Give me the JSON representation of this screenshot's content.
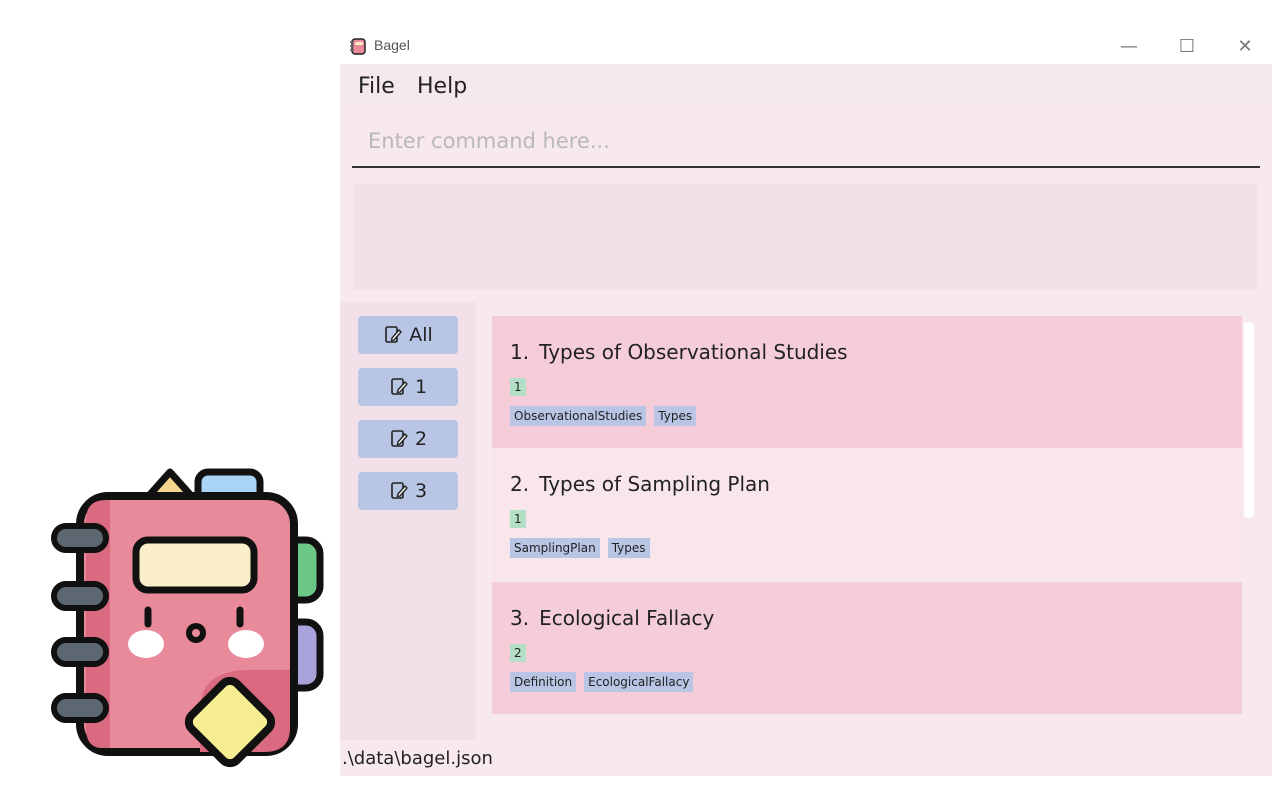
{
  "window": {
    "title": "Bagel",
    "controls": {
      "minimize": "—",
      "maximize": "☐",
      "close": "✕"
    }
  },
  "menu": {
    "items": [
      {
        "label": "File"
      },
      {
        "label": "Help"
      }
    ]
  },
  "command": {
    "placeholder": "Enter command here...",
    "value": ""
  },
  "result": {
    "text": ""
  },
  "tabs": [
    {
      "label": "All",
      "icon": "edit-note-icon"
    },
    {
      "label": "1",
      "icon": "edit-note-icon"
    },
    {
      "label": "2",
      "icon": "edit-note-icon"
    },
    {
      "label": "3",
      "icon": "edit-note-icon"
    }
  ],
  "cards": [
    {
      "index": "1.",
      "title": "Types of Observational Studies",
      "set": "1",
      "tags": [
        "ObservationalStudies",
        "Types"
      ]
    },
    {
      "index": "2.",
      "title": "Types of Sampling Plan",
      "set": "1",
      "tags": [
        "SamplingPlan",
        "Types"
      ]
    },
    {
      "index": "3.",
      "title": "Ecological Fallacy",
      "set": "2",
      "tags": [
        "Definition",
        "EcologicalFallacy"
      ]
    }
  ],
  "status": {
    "file_path": ".\\data\\bagel.json"
  },
  "colors": {
    "window_bg": "#f7e9ef",
    "card_highlight": "#f4cdd9",
    "tag_bg": "#b9c5e4",
    "set_badge_bg": "#b4dfc7"
  }
}
